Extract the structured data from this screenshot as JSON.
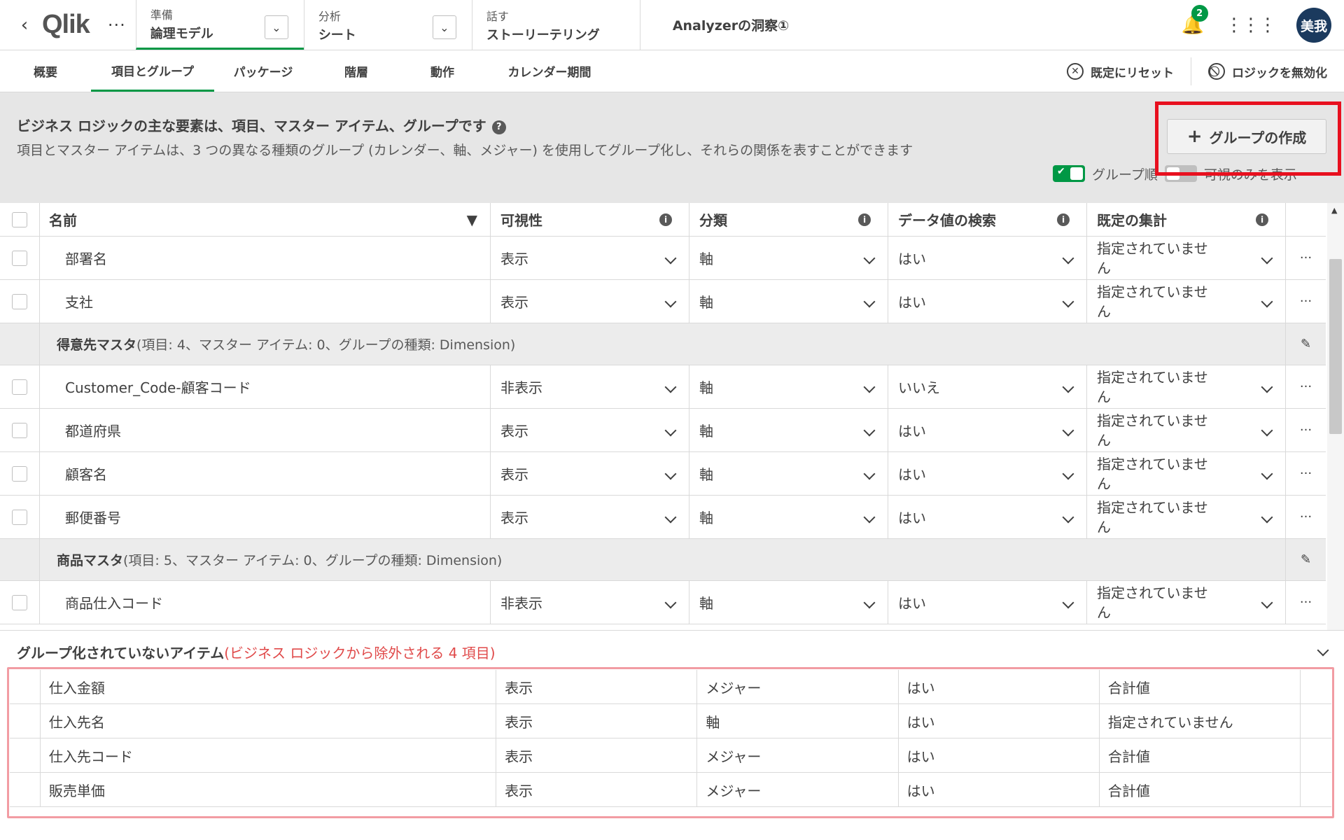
{
  "topbar": {
    "logo": "Qlik",
    "steps": [
      {
        "small": "準備",
        "big": "論理モデル"
      },
      {
        "small": "分析",
        "big": "シート"
      },
      {
        "small": "話す",
        "big": "ストーリーテリング"
      }
    ],
    "app_title": "Analyzerの洞察①",
    "notification_count": "2",
    "avatar_initials": "美我"
  },
  "tabs": [
    "概要",
    "項目とグループ",
    "パッケージ",
    "階層",
    "動作",
    "カレンダー期間"
  ],
  "tab_actions": {
    "reset": "既定にリセット",
    "disable_logic": "ロジックを無効化"
  },
  "info": {
    "title": "ビジネス ロジックの主な要素は、項目、マスター アイテム、グループです",
    "description": "項目とマスター アイテムは、3 つの異なる種類のグループ (カレンダー、軸、メジャー) を使用してグループ化し、それらの関係を表すことができます",
    "create_group_label": "グループの作成",
    "toggle1_label": "グループ順",
    "toggle2_label": "可視のみを表示"
  },
  "table": {
    "headers": [
      "名前",
      "可視性",
      "分類",
      "データ値の検索",
      "既定の集計"
    ],
    "rows": [
      {
        "type": "item",
        "name": "部署名",
        "visibility": "表示",
        "class": "軸",
        "search": "はい",
        "agg1": "指定されていませ",
        "agg2": "ん"
      },
      {
        "type": "item",
        "name": "支社",
        "visibility": "表示",
        "class": "軸",
        "search": "はい",
        "agg1": "指定されていませ",
        "agg2": "ん"
      },
      {
        "type": "group",
        "name": "得意先マスタ",
        "meta": "(項目: 4、マスター アイテム: 0、グループの種類: Dimension)"
      },
      {
        "type": "item",
        "name": "Customer_Code-顧客コード",
        "visibility": "非表示",
        "class": "軸",
        "search": "いいえ",
        "agg1": "指定されていませ",
        "agg2": "ん"
      },
      {
        "type": "item",
        "name": "都道府県",
        "visibility": "表示",
        "class": "軸",
        "search": "はい",
        "agg1": "指定されていませ",
        "agg2": "ん"
      },
      {
        "type": "item",
        "name": "顧客名",
        "visibility": "表示",
        "class": "軸",
        "search": "はい",
        "agg1": "指定されていませ",
        "agg2": "ん"
      },
      {
        "type": "item",
        "name": "郵便番号",
        "visibility": "表示",
        "class": "軸",
        "search": "はい",
        "agg1": "指定されていませ",
        "agg2": "ん"
      },
      {
        "type": "group",
        "name": "商品マスタ",
        "meta": "(項目: 5、マスター アイテム: 0、グループの種類: Dimension)"
      },
      {
        "type": "item",
        "name": "商品仕入コード",
        "visibility": "非表示",
        "class": "軸",
        "search": "はい",
        "agg1": "指定されていませ",
        "agg2": "ん"
      }
    ]
  },
  "ungrouped": {
    "title": "グループ化されていないアイテム",
    "note": "(ビジネス ロジックから除外される 4 項目)",
    "rows": [
      {
        "name": "仕入金額",
        "visibility": "表示",
        "class": "メジャー",
        "search": "はい",
        "agg": "合計値"
      },
      {
        "name": "仕入先名",
        "visibility": "表示",
        "class": "軸",
        "search": "はい",
        "agg": "指定されていません"
      },
      {
        "name": "仕入先コード",
        "visibility": "表示",
        "class": "メジャー",
        "search": "はい",
        "agg": "合計値"
      },
      {
        "name": "販売単価",
        "visibility": "表示",
        "class": "メジャー",
        "search": "はい",
        "agg": "合計値"
      }
    ]
  },
  "colors": {
    "accent": "#009845",
    "highlight_red": "#e8101f",
    "note_red": "#e04a4a"
  }
}
